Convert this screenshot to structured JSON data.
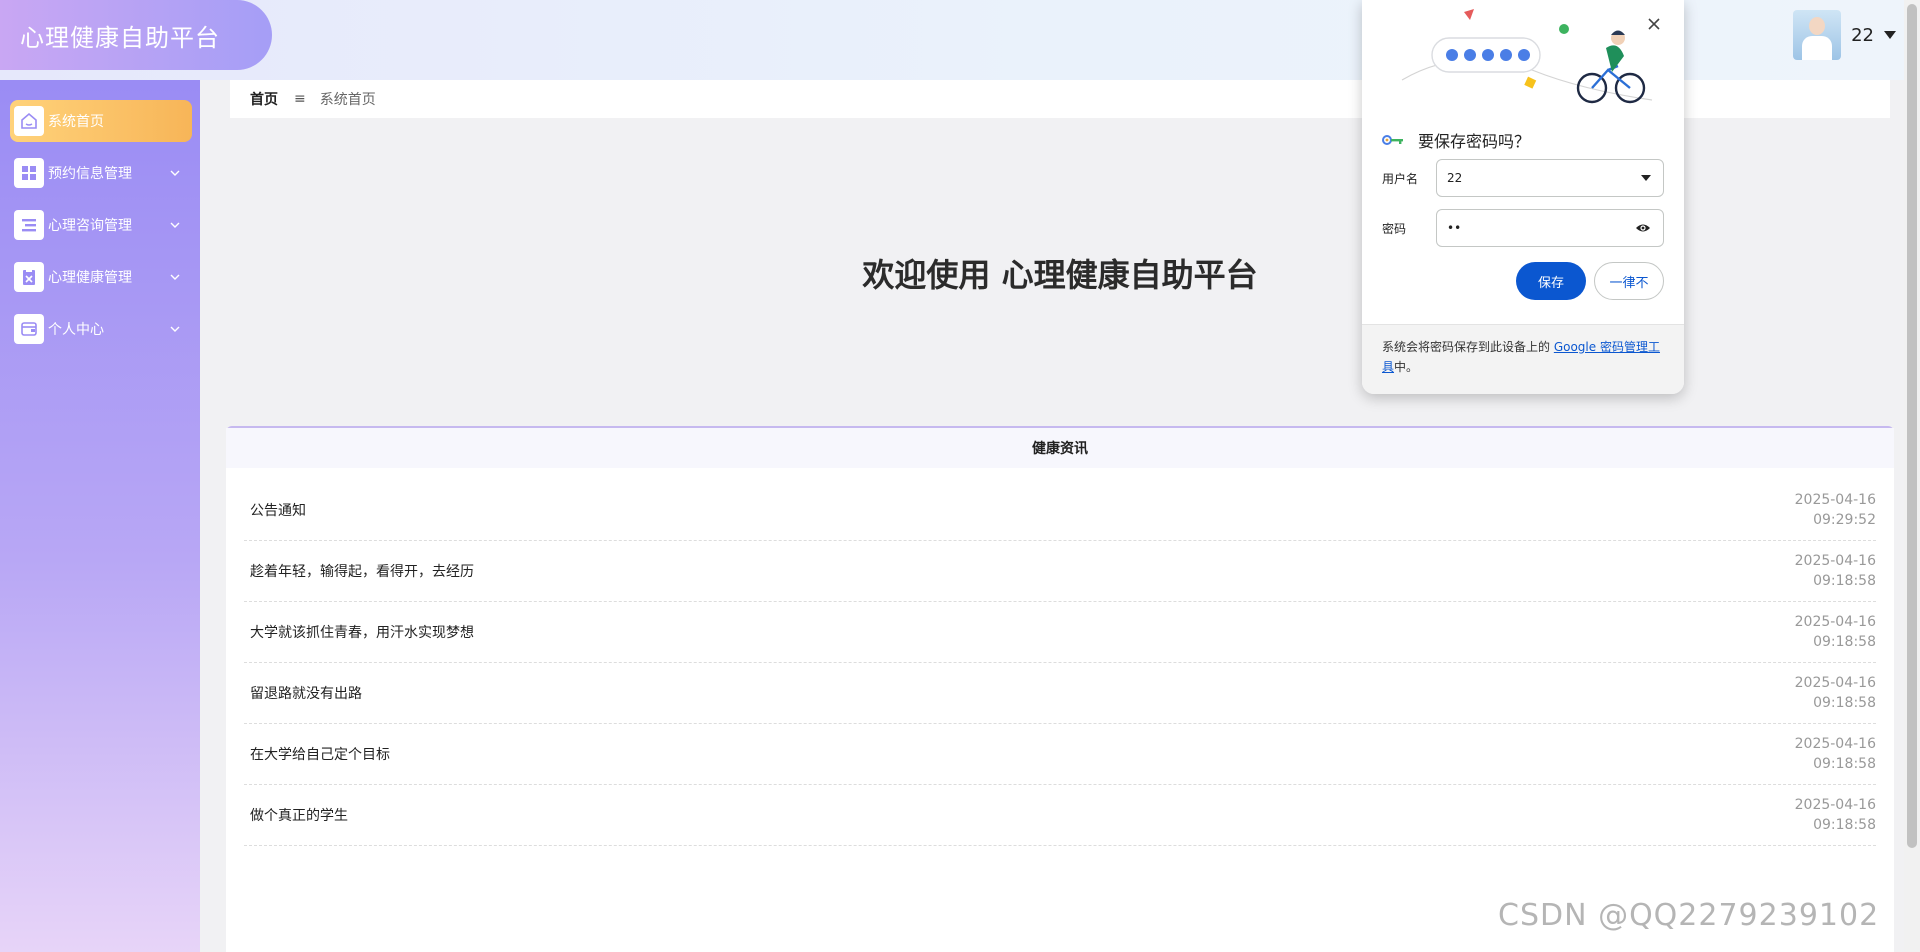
{
  "header": {
    "app_title": "心理健康自助平台",
    "username": "22"
  },
  "sidebar": {
    "items": [
      {
        "label": "系统首页",
        "icon": "home-icon",
        "active": true
      },
      {
        "label": "预约信息管理",
        "icon": "grid-icon",
        "active": false
      },
      {
        "label": "心理咨询管理",
        "icon": "list-icon",
        "active": false
      },
      {
        "label": "心理健康管理",
        "icon": "clipboard-icon",
        "active": false
      },
      {
        "label": "个人中心",
        "icon": "wallet-icon",
        "active": false
      }
    ]
  },
  "breadcrumb": {
    "home": "首页",
    "separator": "≡",
    "current": "系统首页"
  },
  "welcome": {
    "text": "欢迎使用 心理健康自助平台"
  },
  "news": {
    "title": "健康资讯",
    "items": [
      {
        "title": "公告通知",
        "date": "2025-04-16",
        "time": "09:29:52"
      },
      {
        "title": "趁着年轻，输得起，看得开，去经历",
        "date": "2025-04-16",
        "time": "09:18:58"
      },
      {
        "title": "大学就该抓住青春，用汗水实现梦想",
        "date": "2025-04-16",
        "time": "09:18:58"
      },
      {
        "title": "留退路就没有出路",
        "date": "2025-04-16",
        "time": "09:18:58"
      },
      {
        "title": "在大学给自己定个目标",
        "date": "2025-04-16",
        "time": "09:18:58"
      },
      {
        "title": "做个真正的学生",
        "date": "2025-04-16",
        "time": "09:18:58"
      }
    ]
  },
  "password_popup": {
    "question": "要保存密码吗？",
    "username_label": "用户名",
    "username_value": "22",
    "password_label": "密码",
    "password_value": "••",
    "save_label": "保存",
    "never_label": "一律不",
    "footer_prefix": "系统会将密码保存到此设备上的 ",
    "footer_link": "Google 密码管理工具",
    "footer_suffix": "中。"
  },
  "watermark": "CSDN @QQ2279239102",
  "colors": {
    "sidebar_top": "#9a8cf4",
    "sidebar_bottom": "#e7d4f8",
    "active_item": "#f7b558",
    "google_blue": "#0b57d0"
  }
}
